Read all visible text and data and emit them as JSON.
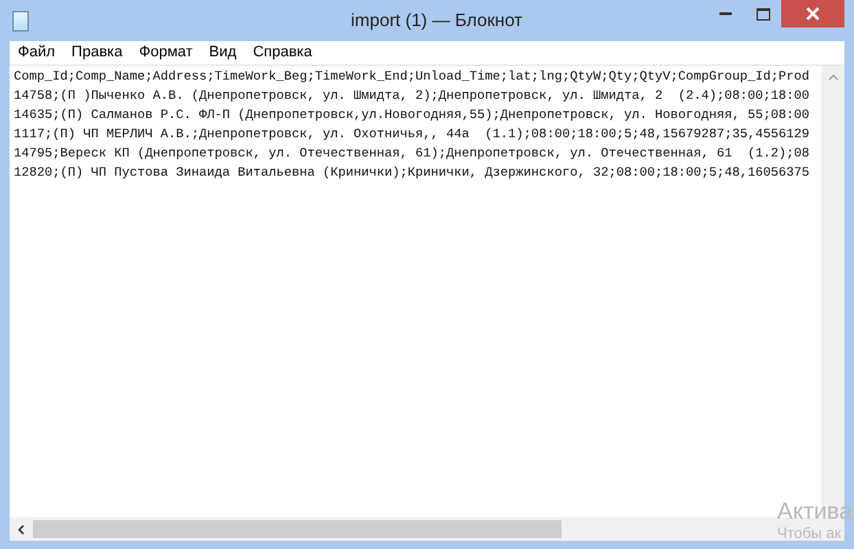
{
  "window": {
    "title": "import (1) — Блокнот"
  },
  "menu": [
    "Файл",
    "Правка",
    "Формат",
    "Вид",
    "Справка"
  ],
  "lines": [
    "Comp_Id;Comp_Name;Address;TimeWork_Beg;TimeWork_End;Unload_Time;lat;lng;QtyW;Qty;QtyV;CompGroup_Id;Prod",
    "14758;(П )Пыченко А.В. (Днепропетровск, ул. Шмидта, 2);Днепропетровск, ул. Шмидта, 2  (2.4);08:00;18:00",
    "14635;(П) Салманов Р.С. ФЛ-П (Днепропетровск,ул.Новогодняя,55);Днепропетровск, ул. Новогодняя, 55;08:00",
    "1117;(П) ЧП МЕРЛИЧ А.В.;Днепропетровск, ул. Охотничья,, 44а  (1.1);08:00;18:00;5;48,15679287;35,4556129",
    "14795;Вереск КП (Днепропетровск, ул. Отечественная, 61);Днепропетровск, ул. Отечественная, 61  (1.2);08",
    "12820;(П) ЧП Пустова Зинаида Витальевна (Кринички);Кринички, Дзержинского, 32;08:00;18:00;5;48,16056375"
  ],
  "activation": [
    "Актива",
    "Чтобы ак"
  ]
}
